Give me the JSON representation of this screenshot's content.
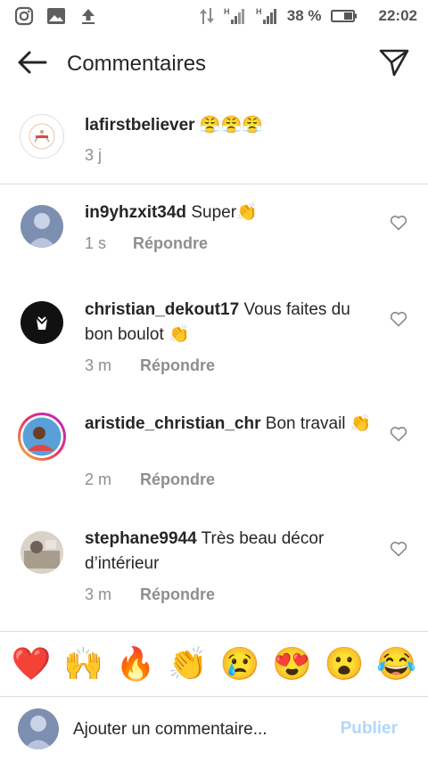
{
  "status_bar": {
    "left_icons": [
      "instagram-icon",
      "gallery-icon",
      "upload-icon"
    ],
    "signal_labels": [
      "H",
      "H"
    ],
    "battery_percent": "38 %",
    "time": "22:02"
  },
  "header": {
    "title": "Commentaires",
    "back_icon": "arrow-left-icon",
    "share_icon": "send-icon"
  },
  "caption": {
    "username": "lafirstbeliever",
    "emojis": "😤😤😤",
    "time": "3 j"
  },
  "comments": [
    {
      "username": "in9yhzxit34d",
      "text": "Super👏",
      "time": "1 s",
      "reply_label": "Répondre"
    },
    {
      "username": "christian_dekout17",
      "text": "Vous faites du bon boulot 👏",
      "time": "3 m",
      "reply_label": "Répondre"
    },
    {
      "username": "aristide_christian_chr",
      "text": "Bon travail 👏",
      "time": "2 m",
      "reply_label": "Répondre"
    },
    {
      "username": "stephane9944",
      "text": "Très beau décor d’intérieur",
      "time": "3 m",
      "reply_label": "Répondre"
    }
  ],
  "emoji_bar": [
    "❤️",
    "🙌",
    "🔥",
    "👏",
    "😢",
    "😍",
    "😮",
    "😂"
  ],
  "composer": {
    "placeholder": "Ajouter un commentaire...",
    "post_label": "Publier"
  },
  "colors": {
    "accent_disabled": "#b3d7f5",
    "secondary_text": "#8e8e8e",
    "divider": "#dbdbdb"
  }
}
